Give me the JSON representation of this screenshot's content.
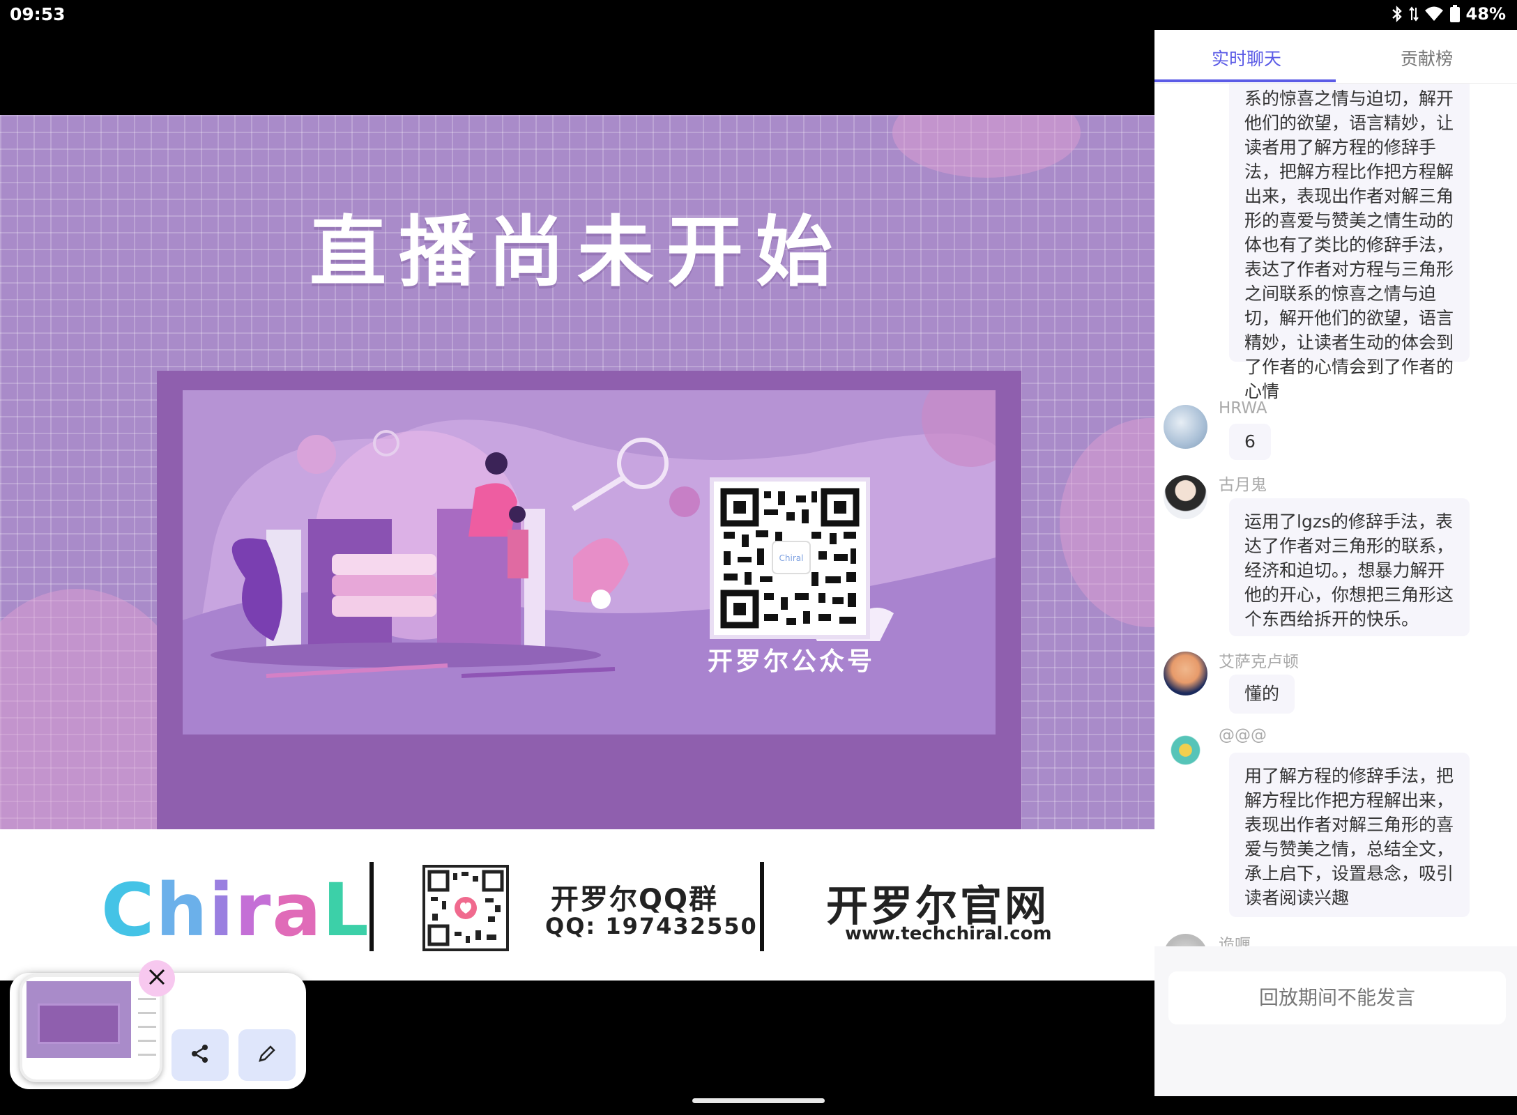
{
  "status_bar": {
    "time": "09:53",
    "battery": "48%"
  },
  "video": {
    "title": "直播尚未开始",
    "qr_caption": "开罗尔公众号",
    "footer": {
      "logo": "Chiral",
      "qq_title": "开罗尔QQ群",
      "qq_number": "QQ: 197432550",
      "site_title": "开罗尔官网",
      "site_url": "www.techchiral.com"
    }
  },
  "panel": {
    "tabs": [
      {
        "label": "实时聊天",
        "active": true
      },
      {
        "label": "贡献榜",
        "active": false
      }
    ],
    "messages": [
      {
        "name": "",
        "text": "系的惊喜之情与迫切，解开他们的欲望，语言精妙，让读者用了解方程的修辞手法，把解方程比作把方程解出来，表现出作者对解三角形的喜爱与赞美之情生动的体也有了类比的修辞手法，表达了作者对方程与三角形之间联系的惊喜之情与迫切，解开他们的欲望，语言精妙，让读者生动的体会到了作者的心情会到了作者的心情"
      },
      {
        "name": "HRWA",
        "text": "6"
      },
      {
        "name": "古月鬼",
        "text": "运用了lgzs的修辞手法，表达了作者对三角形的联系，经济和迫切。，想暴力解开他的开心，你想把三角形这个东西给拆开的快乐。"
      },
      {
        "name": "艾萨克卢顿",
        "text": "懂的"
      },
      {
        "name": "@@@",
        "text": "用了解方程的修辞手法，把解方程比作把方程解出来，表现出作者对解三角形的喜爱与赞美之情，总结全文，承上启下，设置悬念，吸引读者阅读兴趣"
      },
      {
        "name": "诡喱",
        "text": ""
      }
    ],
    "composer_placeholder": "回放期间不能发言"
  },
  "colors": {
    "accent": "#5b5be6",
    "video_bg": "#a98bc9"
  }
}
